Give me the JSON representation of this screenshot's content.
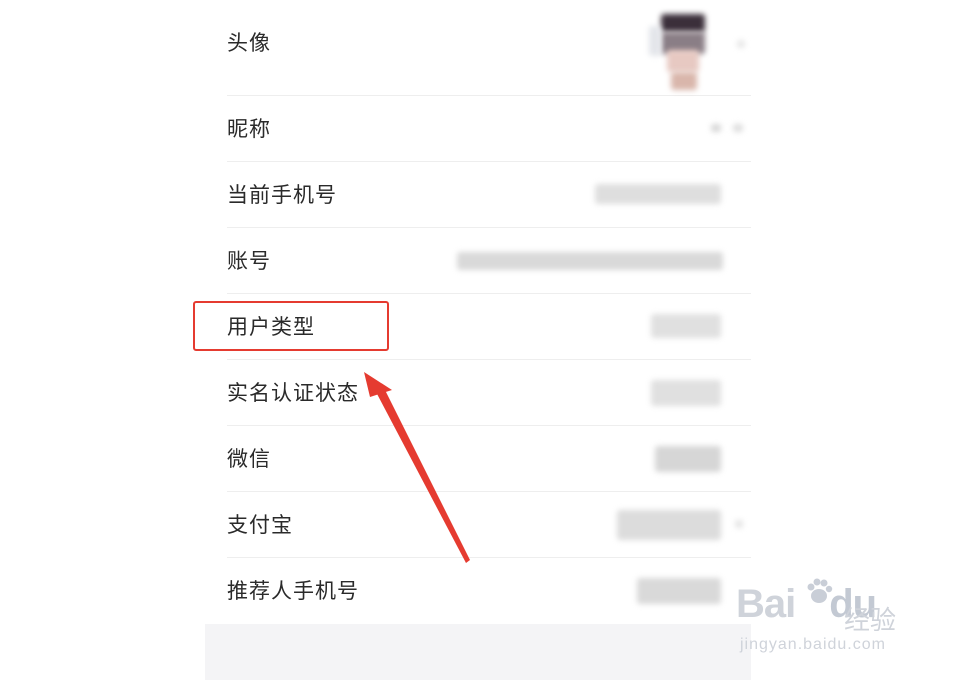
{
  "profile": {
    "rows": [
      {
        "label": "头像"
      },
      {
        "label": "昵称"
      },
      {
        "label": "当前手机号"
      },
      {
        "label": "账号"
      },
      {
        "label": "用户类型"
      },
      {
        "label": "实名认证状态"
      },
      {
        "label": "微信"
      },
      {
        "label": "支付宝"
      },
      {
        "label": "推荐人手机号"
      }
    ]
  },
  "annotation": {
    "highlight_color": "#e53b30",
    "highlighted_row": "用户类型"
  },
  "watermark": {
    "brand_text_1": "Bai",
    "brand_text_2": "du",
    "product": "经验",
    "url": "jingyan.baidu.com"
  }
}
